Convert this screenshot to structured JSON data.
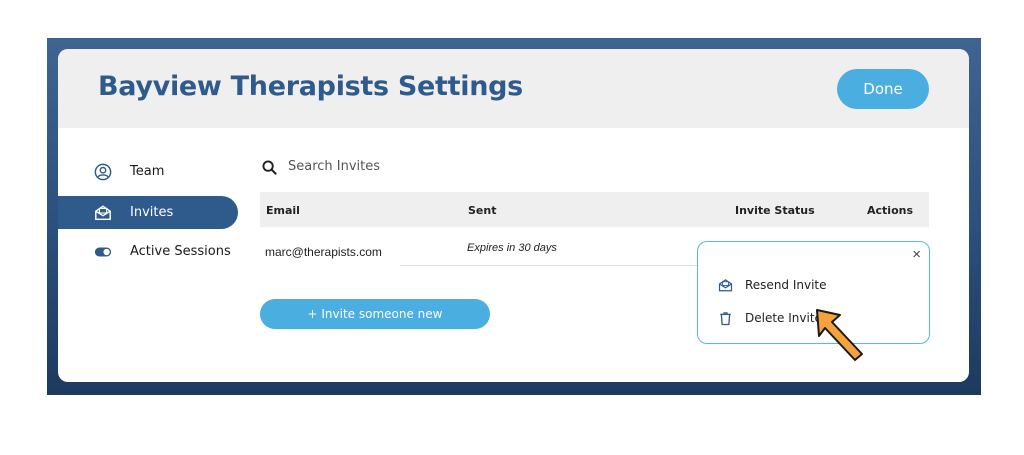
{
  "header": {
    "title": "Bayview Therapists Settings",
    "done_label": "Done"
  },
  "sidebar": {
    "items": [
      {
        "label": "Team",
        "icon": "user-circle-icon",
        "active": false
      },
      {
        "label": "Invites",
        "icon": "envelope-open-icon",
        "active": true
      },
      {
        "label": "Active Sessions",
        "icon": "toggle-icon",
        "active": false
      }
    ]
  },
  "search": {
    "placeholder": "Search Invites"
  },
  "table": {
    "columns": [
      "Email",
      "Sent",
      "Invite Status",
      "Actions"
    ],
    "rows": [
      {
        "email": "marc@therapists.com",
        "sent": "Expires in 30 days"
      }
    ]
  },
  "invite_button": {
    "label": "+ Invite someone new"
  },
  "actions_menu": {
    "close_glyph": "×",
    "items": [
      {
        "label": "Resend Invite",
        "icon": "envelope-open-icon"
      },
      {
        "label": "Delete Invite",
        "icon": "trash-icon"
      }
    ]
  },
  "colors": {
    "brand": "#2f5b8c",
    "accent": "#4aaee0",
    "popup_border": "#56b9e6",
    "pointer": "#f5a23a"
  }
}
